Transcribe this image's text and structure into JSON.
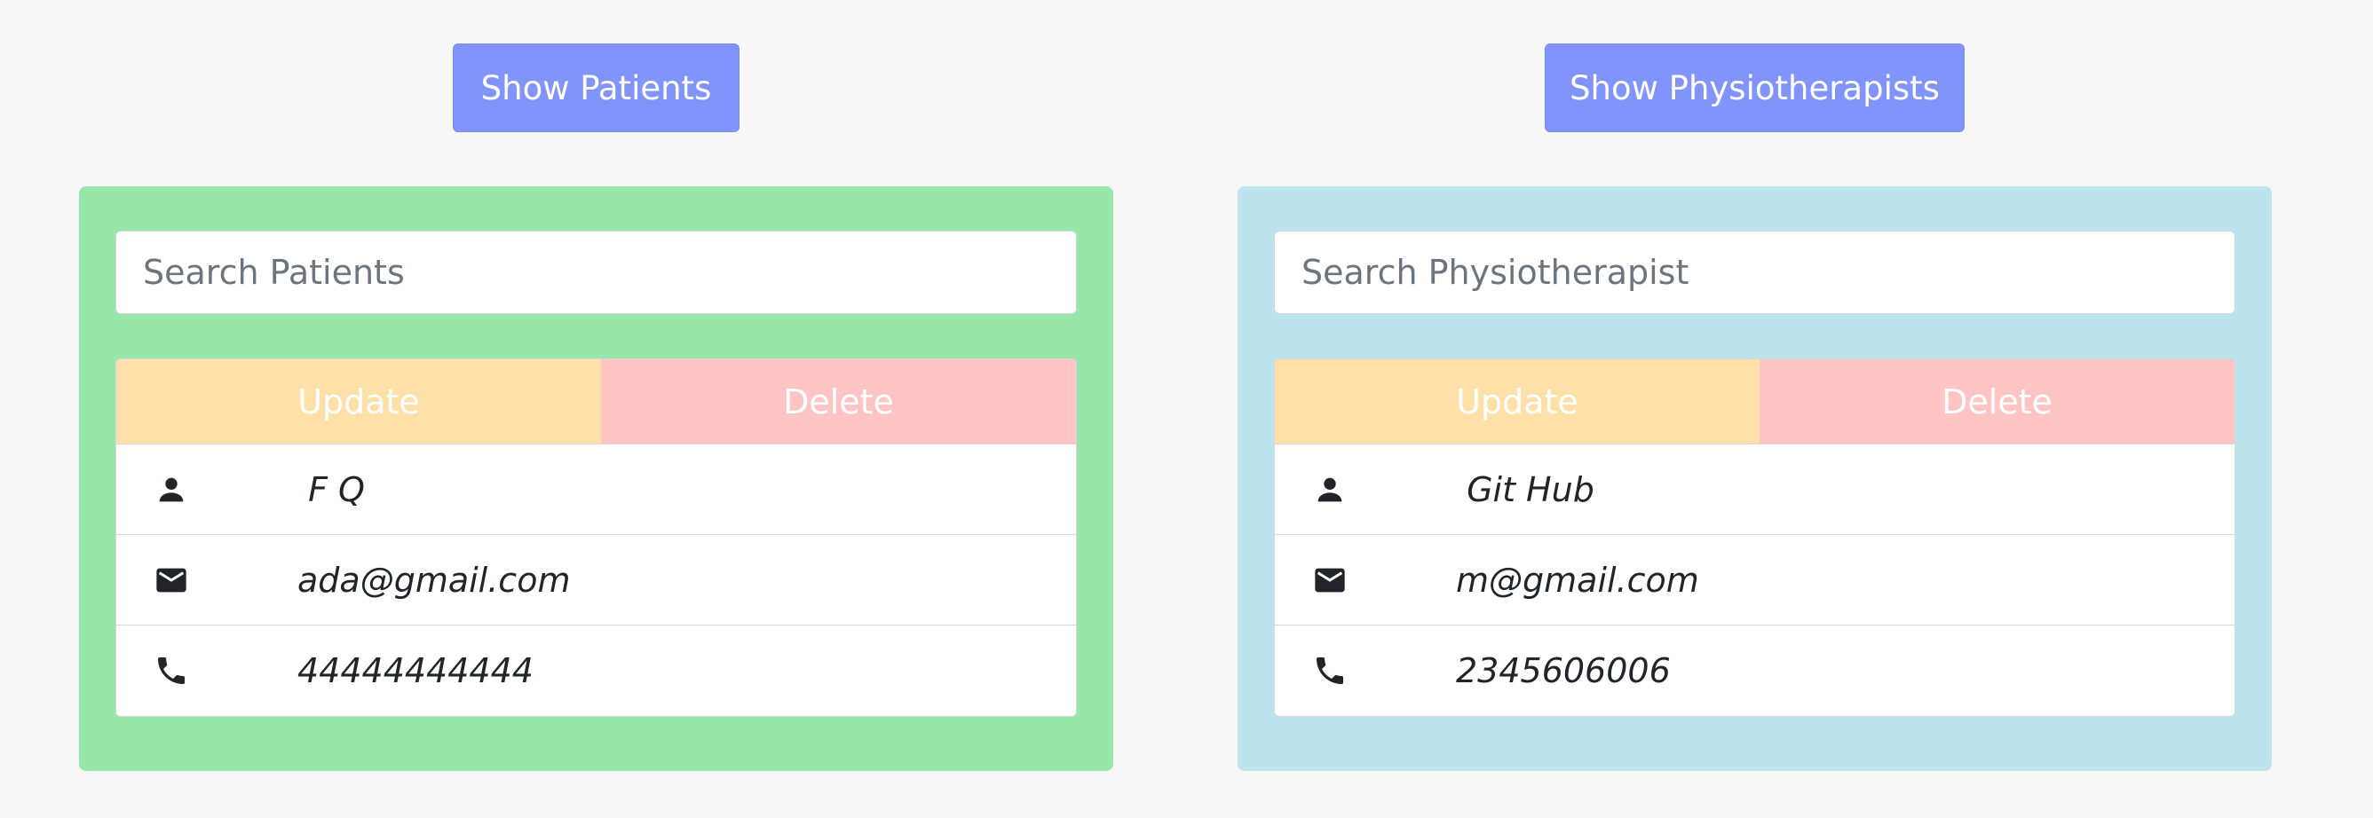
{
  "colors": {
    "background": "#f7f7f7",
    "show_button": "#8094fc",
    "patients_panel": "#98e6a9",
    "physio_panel": "#bde3ec",
    "update": "#ffe0a8",
    "delete": "#ffc4c4",
    "icon": "#212529"
  },
  "toolbar": {
    "show_patients_label": "Show Patients",
    "show_physiotherapists_label": "Show Physiotherapists"
  },
  "patients": {
    "search_placeholder": "Search Patients",
    "update_label": "Update",
    "delete_label": "Delete",
    "rows": [
      {
        "icon": "person-icon",
        "value": " F Q"
      },
      {
        "icon": "envelope-icon",
        "value": "ada@gmail.com"
      },
      {
        "icon": "phone-icon",
        "value": "44444444444"
      }
    ]
  },
  "physiotherapists": {
    "search_placeholder": "Search Physiotherapist",
    "update_label": "Update",
    "delete_label": "Delete",
    "rows": [
      {
        "icon": "person-icon",
        "value": " Git Hub"
      },
      {
        "icon": "envelope-icon",
        "value": "m@gmail.com"
      },
      {
        "icon": "phone-icon",
        "value": "2345606006"
      }
    ]
  }
}
